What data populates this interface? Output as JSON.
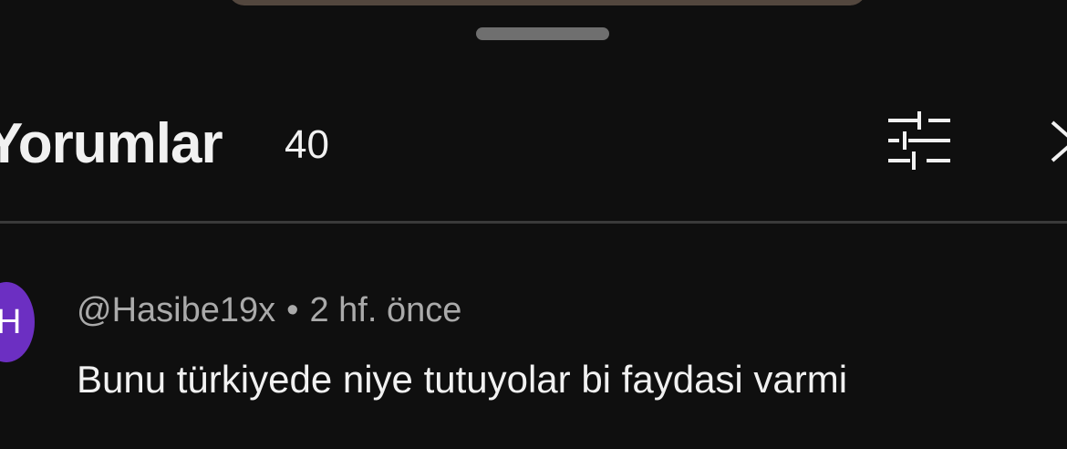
{
  "header": {
    "title": "Yorumlar",
    "count": "40"
  },
  "icons": {
    "filter": "sliders-icon",
    "close": "close-icon"
  },
  "comments": [
    {
      "avatar_letter": "H",
      "author": "@Hasibe19x",
      "separator": "•",
      "time": "2 hf. önce",
      "text": "Bunu türkiyede niye tutuyolar bi faydasi varmi"
    }
  ],
  "colors": {
    "background": "#0f0f0f",
    "avatar": "#6c2fc2",
    "meta_text": "#aaaaaa",
    "primary_text": "#f1f1f1"
  }
}
